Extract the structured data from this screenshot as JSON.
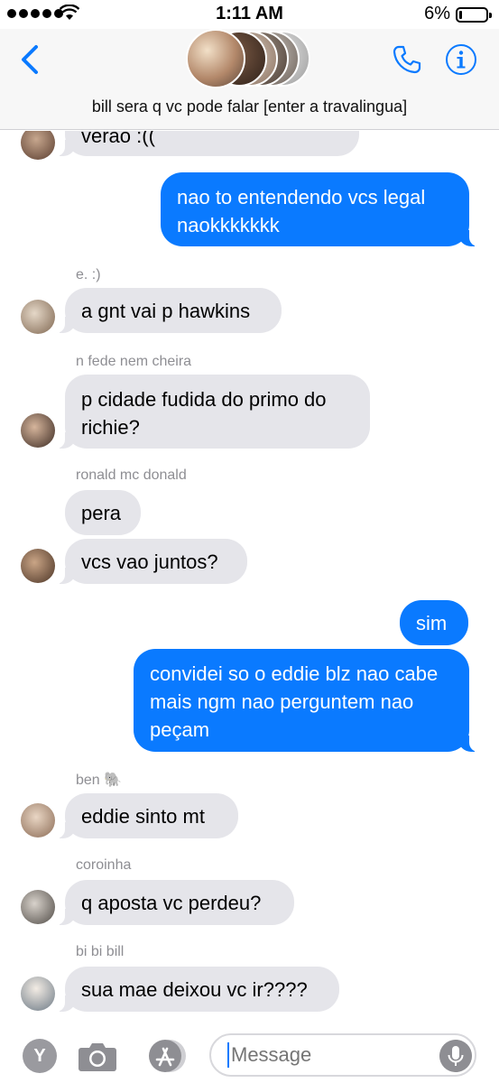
{
  "status_bar": {
    "time": "1:11 AM",
    "battery": "6%"
  },
  "header": {
    "group_name": "bill sera q vc pode falar [enter a travalingua]"
  },
  "messages": [
    {
      "text": "verao :(("
    },
    {
      "text": "nao to entendendo vcs legal naokkkkkkk"
    },
    {
      "sender": "e. :)",
      "text": "a gnt vai p hawkins"
    },
    {
      "sender": "n fede nem cheira",
      "text": "p cidade fudida do primo do richie?"
    },
    {
      "sender": "ronald mc donald",
      "text": "pera"
    },
    {
      "text": "vcs vao juntos?"
    },
    {
      "text": "sim"
    },
    {
      "text": "convidei so o eddie blz nao cabe mais ngm nao perguntem nao peçam"
    },
    {
      "sender": "ben 🐘",
      "text": "eddie sinto mt"
    },
    {
      "sender": "coroinha",
      "text": "q aposta vc perdeu?"
    },
    {
      "sender": "bi bi bill",
      "text": "sua mae deixou vc ir????"
    }
  ],
  "input": {
    "placeholder": "Message",
    "app_letter": "Y"
  },
  "colors": {
    "accent": "#0a7aff",
    "incoming": "#e5e5ea",
    "meta": "#8e8e93"
  }
}
